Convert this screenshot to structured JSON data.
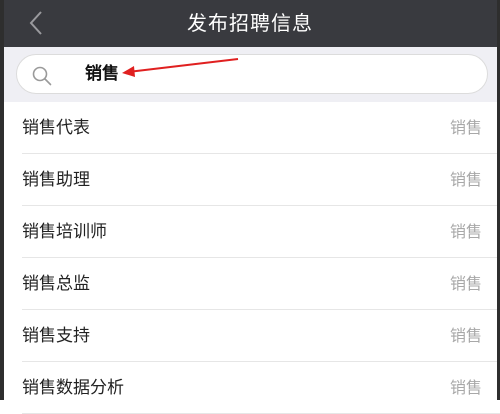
{
  "header": {
    "title": "发布招聘信息",
    "back_icon": "chevron-left-icon"
  },
  "search": {
    "value": "销售",
    "icon": "search-icon"
  },
  "results": [
    {
      "title": "销售代表",
      "category": "销售"
    },
    {
      "title": "销售助理",
      "category": "销售"
    },
    {
      "title": "销售培训师",
      "category": "销售"
    },
    {
      "title": "销售总监",
      "category": "销售"
    },
    {
      "title": "销售支持",
      "category": "销售"
    },
    {
      "title": "销售数据分析",
      "category": "销售"
    }
  ],
  "colors": {
    "header": "#393a3f",
    "annotation_arrow": "#e02020",
    "category_text": "#a8a8a8"
  }
}
